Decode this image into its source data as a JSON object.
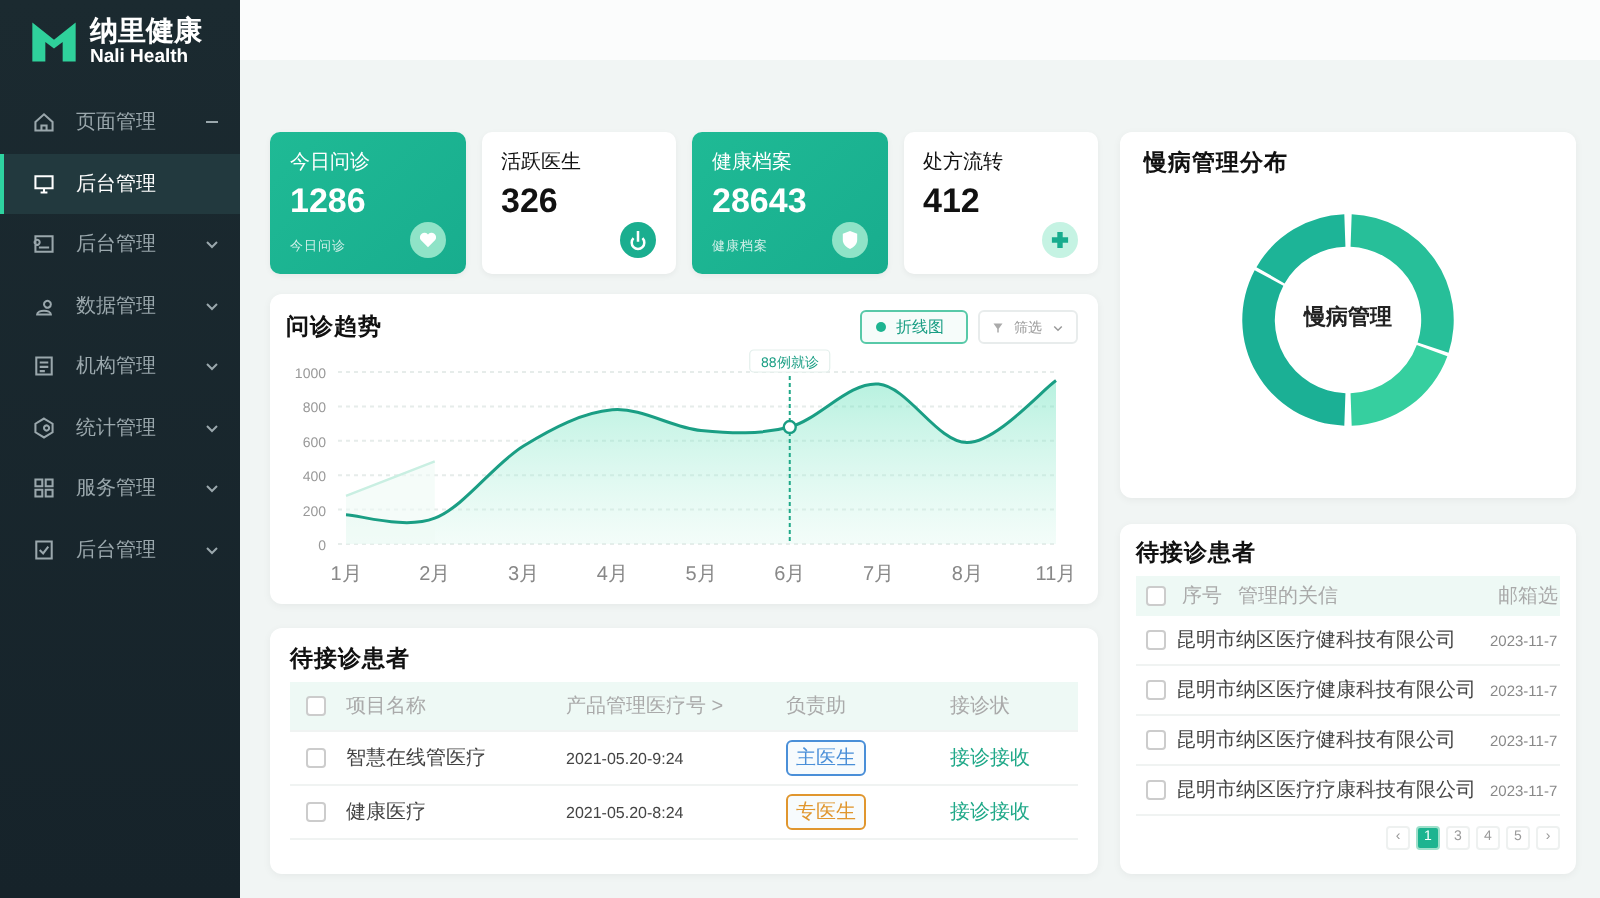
{
  "brand": {
    "name": "纳里健康",
    "subtitle": "Nali Health"
  },
  "sidebar": {
    "items": [
      {
        "label": "页面管理",
        "selected": false,
        "expanded": true
      },
      {
        "label": "后台管理",
        "selected": true
      },
      {
        "label": "后台管理",
        "selected": false,
        "expanded": false
      },
      {
        "label": "数据管理",
        "selected": false,
        "expanded": false
      },
      {
        "label": "机构管理",
        "selected": false,
        "expanded": false
      },
      {
        "label": "统计管理",
        "selected": false,
        "expanded": false
      },
      {
        "label": "服务管理",
        "selected": false,
        "expanded": false
      },
      {
        "label": "后台管理",
        "selected": false,
        "expanded": false
      }
    ]
  },
  "stats": [
    {
      "title": "今日问诊",
      "value": "1286",
      "caption": "今日问诊",
      "highlight": true
    },
    {
      "title": "活跃医生",
      "value": "326",
      "highlight": false
    },
    {
      "title": "健康档案",
      "value": "28643",
      "caption": "健康档案",
      "highlight": true
    },
    {
      "title": "处方流转",
      "value": "412",
      "highlight": false
    }
  ],
  "trend": {
    "title": "问诊趋势",
    "toggle": {
      "label": "折线图",
      "selected": true
    },
    "filter": {
      "label": "筛选"
    },
    "chart_data": {
      "type": "area",
      "categories": [
        "1月",
        "2月",
        "3月",
        "4月",
        "5月",
        "6月",
        "7月",
        "8月",
        "11月"
      ],
      "series": [
        {
          "color": "#1a9e84",
          "values": [
            170,
            150,
            570,
            780,
            660,
            680,
            930,
            590,
            950
          ]
        },
        {
          "color": "#c9efe2",
          "values": [
            280,
            480,
            null,
            null,
            null,
            null,
            null,
            null,
            null
          ]
        }
      ],
      "ylim": [
        0,
        1000
      ],
      "grid": true,
      "yticks": [
        0,
        200,
        400,
        600,
        800,
        1000
      ],
      "annotations": [
        {
          "x": "6月",
          "text": "88例就诊"
        }
      ]
    }
  },
  "waiting": {
    "title": "待接诊患者",
    "header_checked": false,
    "columns": [
      "项目名称",
      "产品管理医疗号 >",
      "负责助",
      "接诊状"
    ],
    "rows": [
      {
        "checked": false,
        "name": "智慧在线管医疗",
        "time": "2021-05.20-9:24",
        "tag": "主医生",
        "color": "#4a8fd8",
        "action": "接诊接收"
      },
      {
        "checked": false,
        "name": "健康医疗",
        "time": "2021-05.20-8:24",
        "tag": "专医生",
        "color": "#e0962e",
        "action": "接诊接收"
      }
    ]
  },
  "distribution": {
    "title": "慢病管理分布",
    "center": "慢病管理"
  },
  "patients": {
    "title": "待接诊患者",
    "header_checked": false,
    "columns": [
      "序号",
      "管理的关信",
      "邮箱选"
    ],
    "rows": [
      {
        "checked": false,
        "company": "昆明市纳区医疗健科技有限公司",
        "date": "2023-11-7"
      },
      {
        "checked": false,
        "company": "昆明市纳区医疗健康科技有限公司",
        "date": "2023-11-7"
      },
      {
        "checked": false,
        "company": "昆明市纳区医疗健科技有限公司",
        "date": "2023-11-7"
      },
      {
        "checked": false,
        "company": "昆明市纳区医疗疗康科技有限公司",
        "date": "2023-11-7"
      }
    ],
    "pagination": {
      "prev": "‹",
      "next": "›",
      "pages": [
        {
          "label": "1",
          "selected": true
        },
        {
          "label": "3",
          "selected": false
        },
        {
          "label": "4",
          "selected": false
        },
        {
          "label": "5",
          "selected": false
        }
      ]
    }
  }
}
